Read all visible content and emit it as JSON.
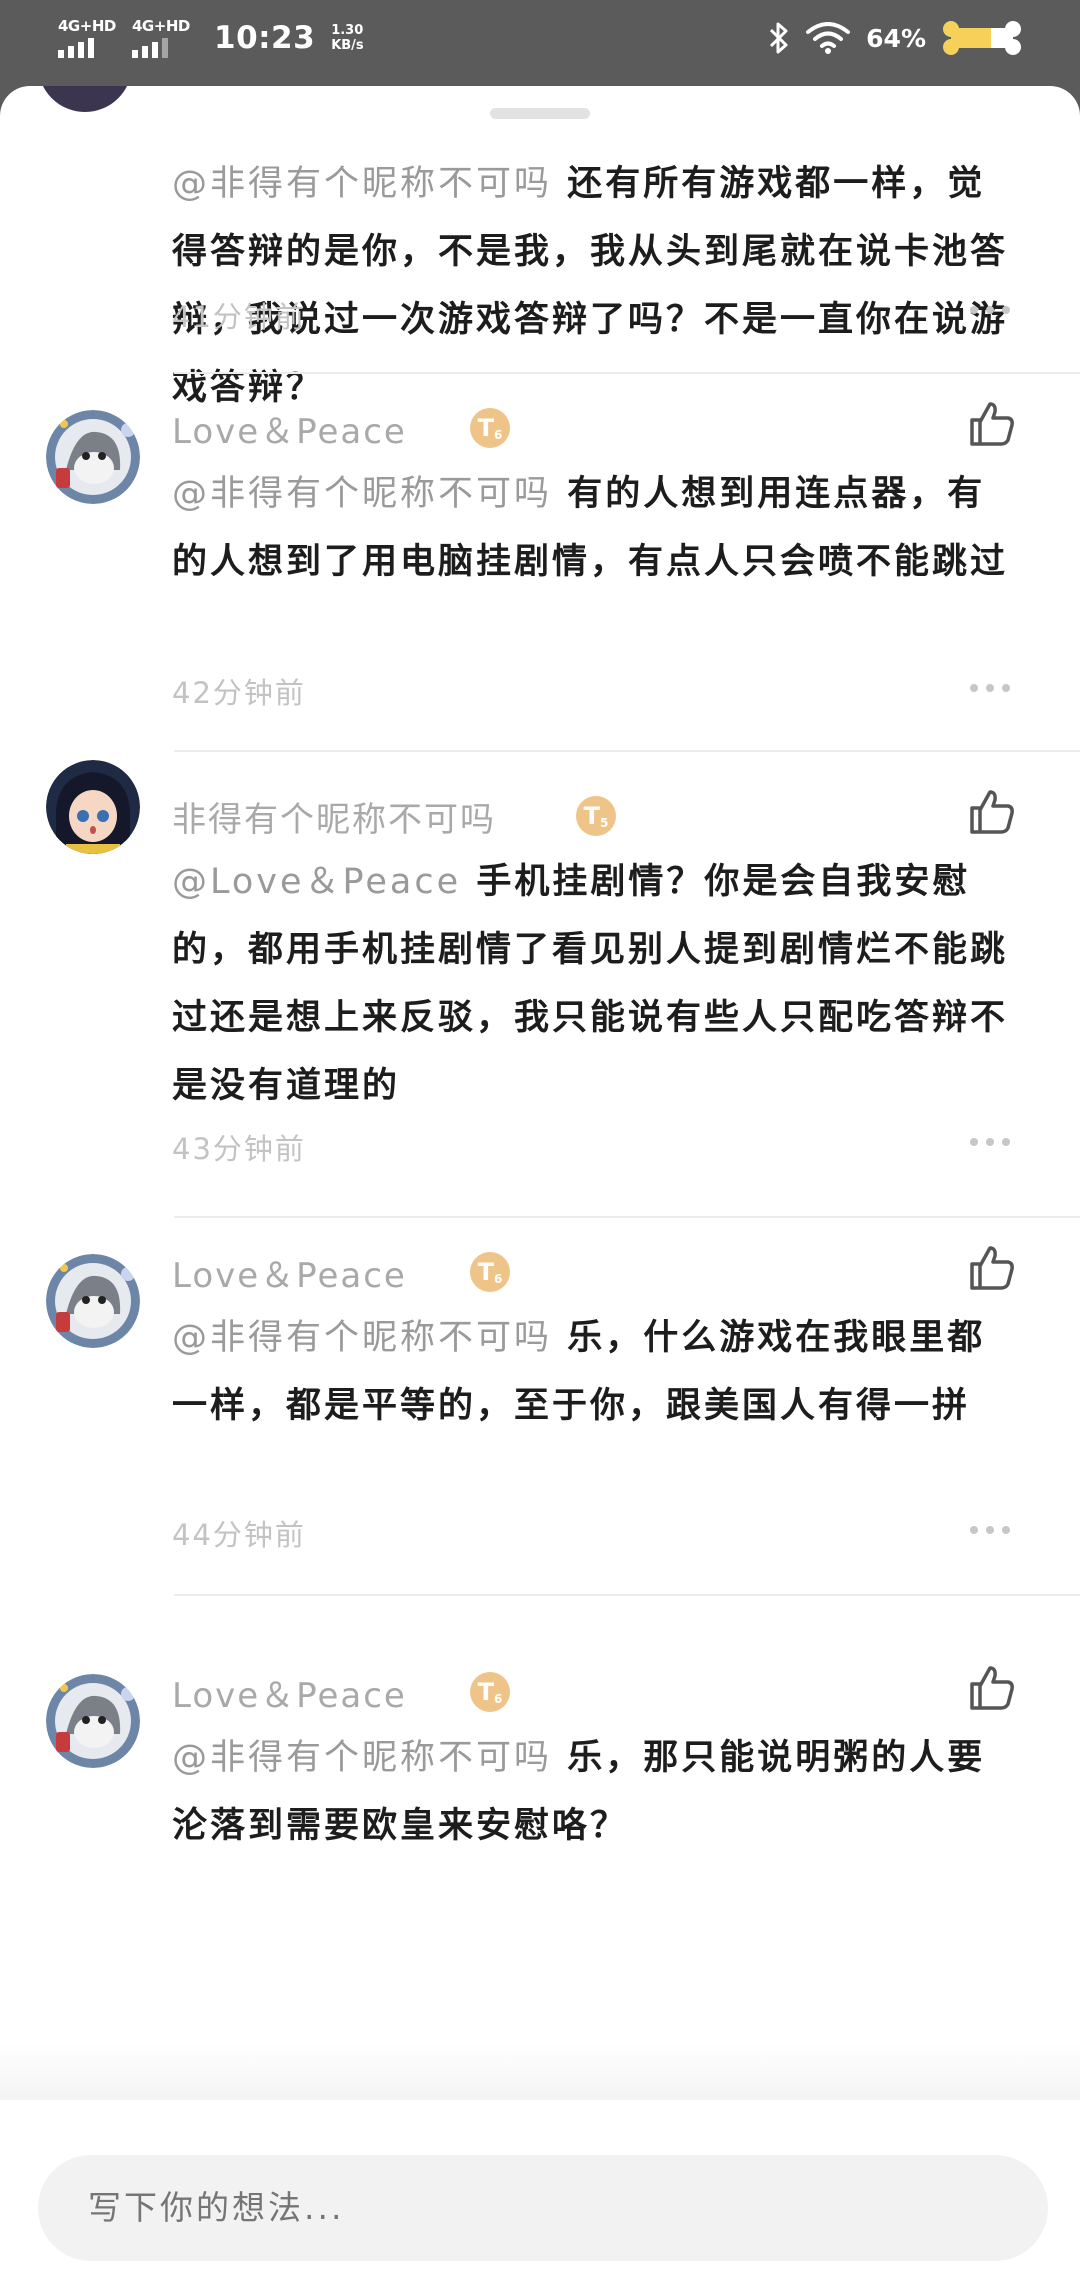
{
  "status_bar": {
    "sim1": "4G+HD",
    "sim2": "4G+HD",
    "time": "10:23",
    "net_speed_value": "1.30",
    "net_speed_unit": "KB/s",
    "battery": "64%",
    "icons": [
      "bluetooth-icon",
      "wifi-icon",
      "battery-icon"
    ]
  },
  "comments": [
    {
      "mention": "@非得有个昵称不可吗",
      "text": " 还有所有游戏都一样，觉得答辩的是你，不是我，我从头到尾就在说卡池答辩，我说过一次游戏答辩了吗？不是一直你在说游戏答辩？",
      "time": "41分钟前"
    },
    {
      "username": "Love＆Peace",
      "badge": "T",
      "badge_level": "6",
      "mention": "@非得有个昵称不可吗",
      "text": " 有的人想到用连点器，有的人想到了用电脑挂剧情，有点人只会喷不能跳过",
      "time": "42分钟前"
    },
    {
      "username": "非得有个昵称不可吗",
      "badge": "T",
      "badge_level": "5",
      "mention": "@Love＆Peace",
      "text": " 手机挂剧情？你是会自我安慰的，都用手机挂剧情了看见别人提到剧情烂不能跳过还是想上来反驳，我只能说有些人只配吃答辩不是没有道理的",
      "time": "43分钟前"
    },
    {
      "username": "Love＆Peace",
      "badge": "T",
      "badge_level": "6",
      "mention": "@非得有个昵称不可吗",
      "text": " 乐，什么游戏在我眼里都一样，都是平等的，至于你，跟美国人有得一拼",
      "time": "44分钟前"
    },
    {
      "username": "Love＆Peace",
      "badge": "T",
      "badge_level": "6",
      "mention": "@非得有个昵称不可吗",
      "text": " 乐，那只能说明粥的人要沦落到需要欧皇来安慰咯？"
    }
  ],
  "input": {
    "placeholder": "写下你的想法..."
  },
  "colors": {
    "badge": "#efc489",
    "text": "#1d1d1d",
    "mention": "#9a9a9a",
    "username": "#a9a9a9"
  }
}
